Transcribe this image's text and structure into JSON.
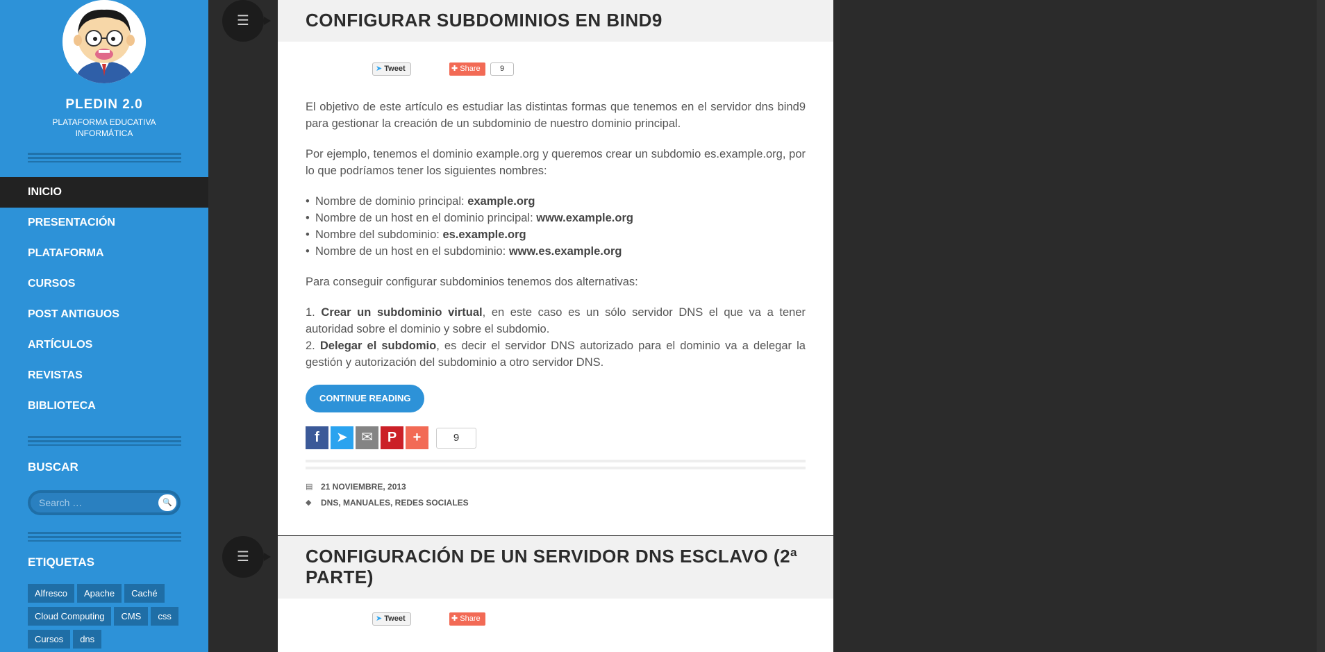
{
  "site": {
    "title": "PLEDIN 2.0",
    "description": "PLATAFORMA EDUCATIVA INFORMÁTICA"
  },
  "nav": [
    {
      "label": "INICIO",
      "active": true
    },
    {
      "label": "PRESENTACIÓN"
    },
    {
      "label": "PLATAFORMA"
    },
    {
      "label": "CURSOS"
    },
    {
      "label": "POST ANTIGUOS"
    },
    {
      "label": "ARTÍCULOS"
    },
    {
      "label": "REVISTAS"
    },
    {
      "label": "BIBLIOTECA"
    }
  ],
  "search": {
    "title": "BUSCAR",
    "placeholder": "Search …"
  },
  "tags": {
    "title": "ETIQUETAS",
    "items": [
      "Alfresco",
      "Apache",
      "Caché",
      "Cloud Computing",
      "CMS",
      "css",
      "Cursos",
      "dns"
    ]
  },
  "post1": {
    "title": "CONFIGURAR SUBDOMINIOS EN BIND9",
    "tweet": "Tweet",
    "share": "Share",
    "share_count": "9",
    "p1": "El objetivo de este artículo es estudiar las distintas formas que tenemos en el servidor dns bind9 para gestionar la creación de un subdominio de nuestro dominio principal.",
    "p2": "Por ejemplo, tenemos el dominio example.org y queremos crear un subdomio es.example.org, por lo que podríamos tener los siguientes nombres:",
    "list": [
      {
        "text": "Nombre de dominio principal: ",
        "bold": "example.org"
      },
      {
        "text": "Nombre de un host en el dominio principal: ",
        "bold": "www.example.org"
      },
      {
        "text": "Nombre del subdominio: ",
        "bold": "es.example.org"
      },
      {
        "text": "Nombre de un host en el subdominio: ",
        "bold": "www.es.example.org"
      }
    ],
    "p3": "Para conseguir configurar subdominios tenemos dos alternativas:",
    "alt1_num": "1. ",
    "alt1_bold": "Crear un subdominio virtual",
    "alt1_text": ", en este caso es un sólo servidor DNS el que va a tener autoridad sobre el dominio y sobre el subdomio.",
    "alt2_num": "2. ",
    "alt2_bold": "Delegar el subdomio",
    "alt2_text": ", es decir el servidor DNS autorizado para el dominio va a delegar la gestión y autorización del subdominio a otro servidor DNS.",
    "continue": "CONTINUE READING",
    "social_count": "9",
    "date": "21 NOVIEMBRE, 2013",
    "categories": "DNS, MANUALES, REDES SOCIALES"
  },
  "post2": {
    "title": "CONFIGURACIÓN DE UN SERVIDOR DNS ESCLAVO (2ª PARTE)",
    "tweet": "Tweet",
    "share": "Share"
  },
  "colors": {
    "sidebar": "#2d92d8",
    "accent": "#2d92d8",
    "background": "#2b2b2b"
  }
}
